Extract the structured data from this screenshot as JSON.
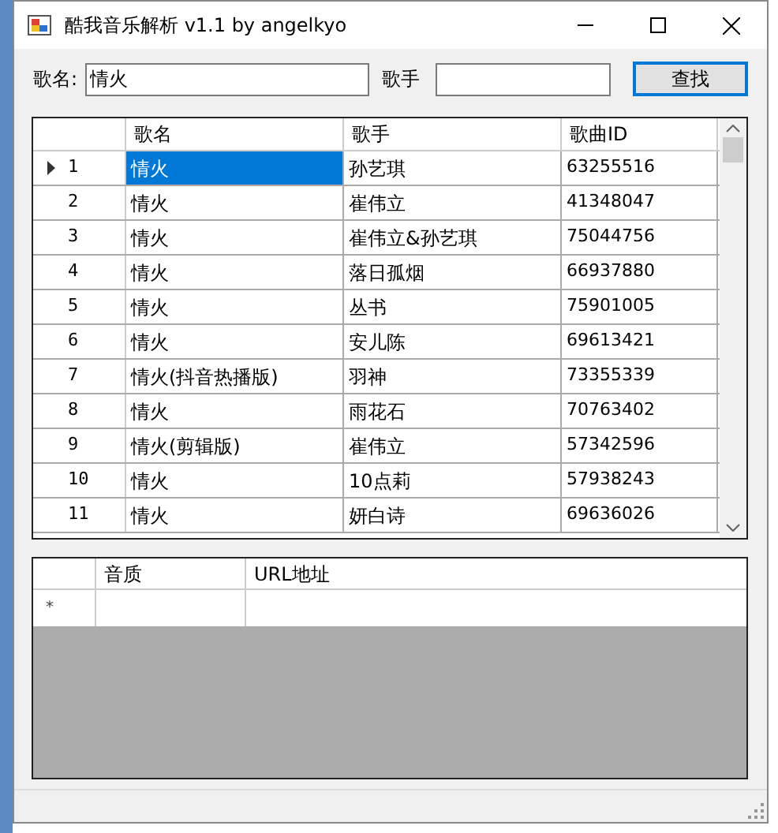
{
  "window": {
    "title": "酷我音乐解析 v1.1 by angelkyo"
  },
  "search": {
    "song_label": "歌名:",
    "song_value": "情火",
    "singer_label": "歌手",
    "button": "查找"
  },
  "results": {
    "columns": [
      "歌名",
      "歌手",
      "歌曲ID"
    ],
    "rows": [
      {
        "index": "1",
        "name": "情火",
        "singer": "孙艺琪",
        "id": "63255516",
        "selected": true
      },
      {
        "index": "2",
        "name": "情火",
        "singer": "崔伟立",
        "id": "41348047",
        "selected": false
      },
      {
        "index": "3",
        "name": "情火",
        "singer": "崔伟立&孙艺琪",
        "id": "75044756",
        "selected": false
      },
      {
        "index": "4",
        "name": "情火",
        "singer": "落日孤烟",
        "id": "66937880",
        "selected": false
      },
      {
        "index": "5",
        "name": "情火",
        "singer": "丛书",
        "id": "75901005",
        "selected": false
      },
      {
        "index": "6",
        "name": "情火",
        "singer": "安儿陈",
        "id": "69613421",
        "selected": false
      },
      {
        "index": "7",
        "name": "情火(抖音热播版)",
        "singer": "羽神",
        "id": "73355339",
        "selected": false
      },
      {
        "index": "8",
        "name": "情火",
        "singer": "雨花石",
        "id": "70763402",
        "selected": false
      },
      {
        "index": "9",
        "name": "情火(剪辑版)",
        "singer": "崔伟立",
        "id": "57342596",
        "selected": false
      },
      {
        "index": "10",
        "name": "情火",
        "singer": "10点莉",
        "id": "57938243",
        "selected": false
      },
      {
        "index": "11",
        "name": "情火",
        "singer": "妍白诗",
        "id": "69636026",
        "selected": false
      }
    ]
  },
  "links": {
    "columns": [
      "音质",
      "URL地址"
    ],
    "new_row_marker": "*"
  }
}
